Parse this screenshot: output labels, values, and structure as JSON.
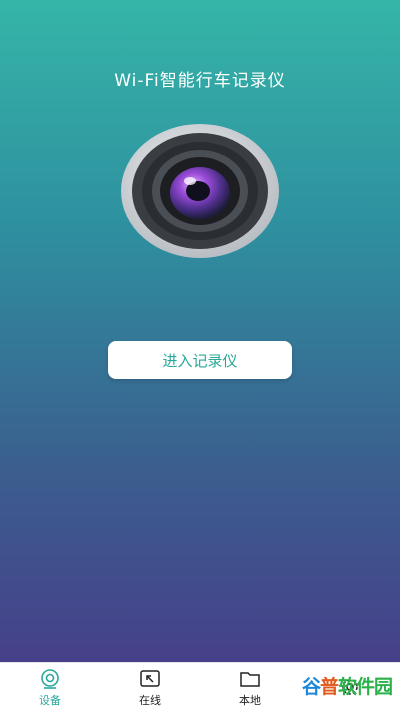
{
  "app": {
    "title": "Wi-Fi智能行车记录仪"
  },
  "main": {
    "enter_button": "进入记录仪"
  },
  "nav": {
    "items": [
      {
        "label": "设备",
        "icon": "camera-icon",
        "active": true
      },
      {
        "label": "在线",
        "icon": "arrow-up-left-box-icon",
        "active": false
      },
      {
        "label": "本地",
        "icon": "folder-icon",
        "active": false
      },
      {
        "label": "",
        "icon": "settings-icon",
        "active": false
      }
    ]
  },
  "watermark": {
    "part1": "谷",
    "part2": "普",
    "part3": "软件园"
  },
  "colors": {
    "accent": "#2aa89a",
    "gradient_top": "#35b5a8",
    "gradient_bottom": "#46408a"
  }
}
